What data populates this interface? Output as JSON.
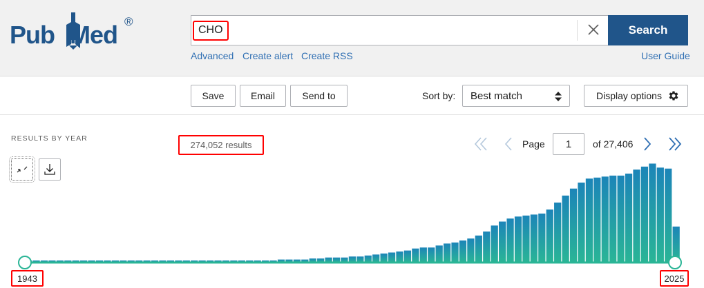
{
  "header": {
    "logo_text": "PubMed",
    "registered_mark": "®",
    "search": {
      "value": "CHO",
      "placeholder": "",
      "button_label": "Search"
    },
    "links": [
      "Advanced",
      "Create alert",
      "Create RSS"
    ],
    "user_guide": "User Guide"
  },
  "toolbar": {
    "save": "Save",
    "email": "Email",
    "send_to": "Send to",
    "sort_by_label": "Sort by:",
    "sort_value": "Best match",
    "display_options": "Display options"
  },
  "timeline": {
    "title": "RESULTS BY YEAR",
    "results_count": "274,052 results",
    "page_label": "Page",
    "page_value": "1",
    "of_pages": "of 27,406",
    "start_year": "1943",
    "end_year": "2025",
    "colors": {
      "bar_top": "#1c85b8",
      "bar_bottom": "#2ab596",
      "slider": "#2ab596"
    }
  },
  "chart_data": {
    "type": "bar",
    "x": [
      "1943",
      "1944",
      "1945",
      "1946",
      "1947",
      "1948",
      "1949",
      "1950",
      "1951",
      "1952",
      "1953",
      "1954",
      "1955",
      "1956",
      "1957",
      "1958",
      "1959",
      "1960",
      "1961",
      "1962",
      "1963",
      "1964",
      "1965",
      "1966",
      "1967",
      "1968",
      "1969",
      "1970",
      "1971",
      "1972",
      "1973",
      "1974",
      "1975",
      "1976",
      "1977",
      "1978",
      "1979",
      "1980",
      "1981",
      "1982",
      "1983",
      "1984",
      "1985",
      "1986",
      "1987",
      "1988",
      "1989",
      "1990",
      "1991",
      "1992",
      "1993",
      "1994",
      "1995",
      "1996",
      "1997",
      "1998",
      "1999",
      "2000",
      "2001",
      "2002",
      "2003",
      "2004",
      "2005",
      "2006",
      "2007",
      "2008",
      "2009",
      "2010",
      "2011",
      "2012",
      "2013",
      "2014",
      "2015",
      "2016",
      "2017",
      "2018",
      "2019",
      "2020",
      "2021",
      "2022",
      "2023",
      "2024",
      "2025"
    ],
    "values": [
      2,
      2,
      2,
      2,
      2,
      2,
      2,
      2,
      2,
      2,
      2,
      2,
      2,
      2,
      2,
      2,
      2,
      2,
      2,
      2,
      2,
      2,
      2,
      2,
      2,
      2,
      2,
      2,
      2,
      2,
      2,
      2,
      3,
      3,
      3,
      3,
      4,
      4,
      5,
      5,
      5,
      6,
      6,
      7,
      8,
      9,
      10,
      11,
      12,
      14,
      15,
      15,
      17,
      19,
      20,
      22,
      24,
      27,
      31,
      37,
      41,
      44,
      46,
      47,
      48,
      49,
      53,
      60,
      67,
      74,
      80,
      84,
      85,
      86,
      87,
      87,
      89,
      93,
      96,
      99,
      95,
      94,
      36
    ]
  }
}
